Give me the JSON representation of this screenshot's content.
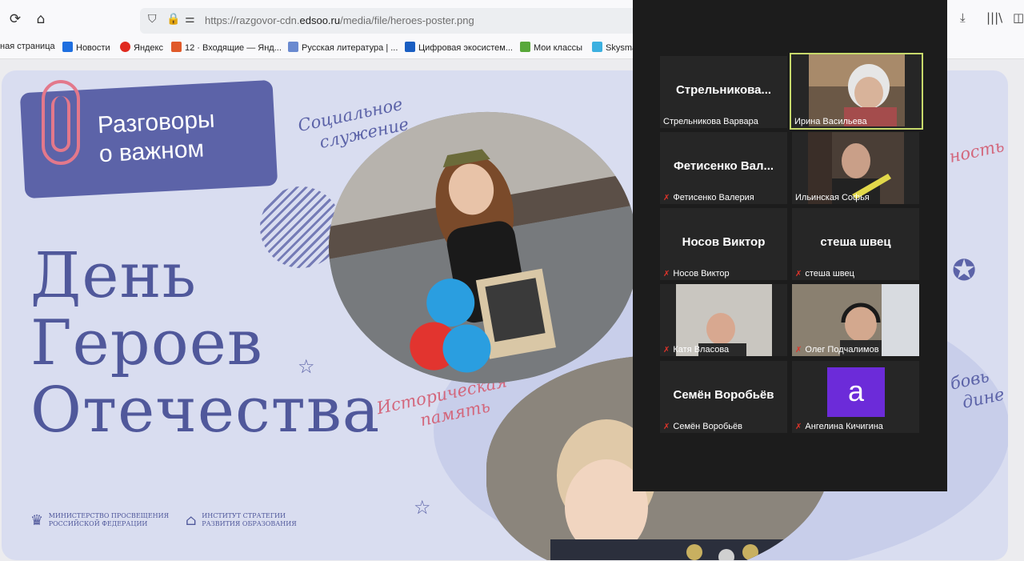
{
  "browser": {
    "url_prefix": "https://razgovor-cdn.",
    "url_domain": "edsoo.ru",
    "url_path": "/media/file/heroes-poster.png",
    "bookmarks": [
      {
        "label": "ная страница",
        "color": "#ffffff"
      },
      {
        "label": "Новости",
        "color": "#1e6fe0"
      },
      {
        "label": "Яндекс",
        "color": "#e02a1f"
      },
      {
        "label": "12 · Входящие — Янд...",
        "color": "#e05a2a"
      },
      {
        "label": "Русская литература | ...",
        "color": "#6a8ad0"
      },
      {
        "label": "Цифровая экосистем...",
        "color": "#1a5ec2"
      },
      {
        "label": "Мои классы",
        "color": "#58a83a"
      },
      {
        "label": "Skysma",
        "color": "#3cb0e0"
      }
    ]
  },
  "poster": {
    "logo_line1": "Разговоры",
    "logo_line2": "о важном",
    "title_line1": "День",
    "title_line2": "Героев",
    "title_line3": "Отечества",
    "script1_line1": "Социальное",
    "script1_line2": "служение",
    "script2_line1": "Историческая",
    "script2_line2": "память",
    "script3": "ность",
    "script4_line1": "бовь",
    "script4_line2": "дине",
    "ministry_line1": "МИНИСТЕРСТВО ПРОСВЕЩЕНИЯ",
    "ministry_line2": "РОССИЙСКОЙ ФЕДЕРАЦИИ",
    "institute_line1": "ИНСТИТУТ СТРАТЕГИИ",
    "institute_line2": "РАЗВИТИЯ ОБРАЗОВАНИЯ"
  },
  "meeting": {
    "participants": [
      {
        "display": "Стрельникова...",
        "name": "Стрельникова Варвара",
        "muted": false,
        "video": false
      },
      {
        "display": "",
        "name": "Ирина Васильева",
        "muted": false,
        "video": true,
        "active": true
      },
      {
        "display": "Фетисенко  Вал...",
        "name": "Фетисенко Валерия",
        "muted": true,
        "video": false
      },
      {
        "display": "",
        "name": "Ильинская Софья",
        "muted": false,
        "video": true
      },
      {
        "display": "Носов Виктор",
        "name": "Носов Виктор",
        "muted": true,
        "video": false
      },
      {
        "display": "стеша швец",
        "name": "стеша швец",
        "muted": true,
        "video": false
      },
      {
        "display": "",
        "name": "Катя Власова",
        "muted": true,
        "video": true
      },
      {
        "display": "",
        "name": "Олег Подчалимов",
        "muted": true,
        "video": true
      },
      {
        "display": "Семён Воробьёв",
        "name": "Семён Воробьёв",
        "muted": true,
        "video": false
      },
      {
        "display": "",
        "name": "Ангелина Кичигина",
        "muted": true,
        "video": false,
        "avatar_letter": "а"
      }
    ]
  }
}
